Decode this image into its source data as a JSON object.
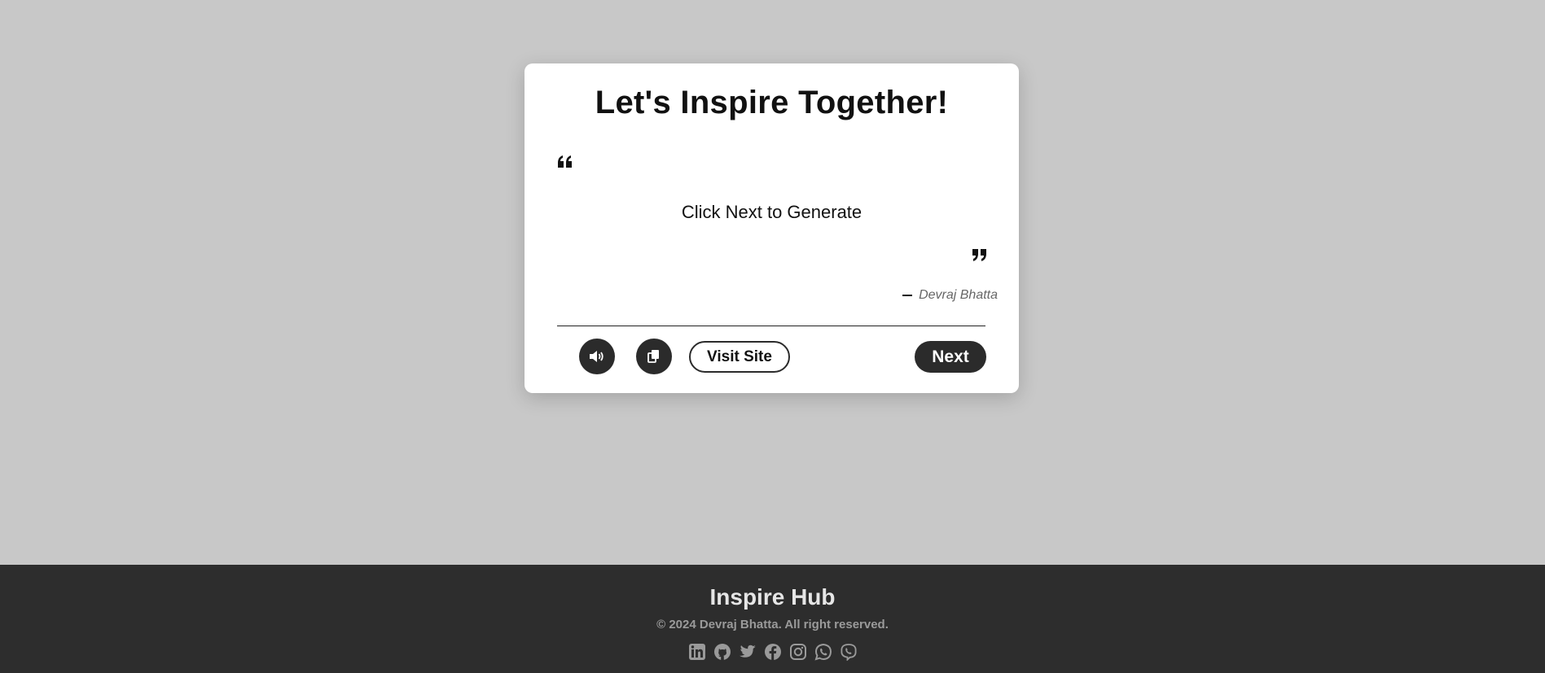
{
  "card": {
    "title": "Let's Inspire Together!",
    "quote_text": "Click Next to Generate",
    "author": "Devraj Bhatta",
    "buttons": {
      "speak_icon": "volume-icon",
      "copy_icon": "copy-icon",
      "visit_label": "Visit Site",
      "next_label": "Next"
    }
  },
  "footer": {
    "title": "Inspire Hub",
    "copyright": "© 2024 Devraj Bhatta. All right reserved.",
    "socials": [
      "linkedin-icon",
      "github-icon",
      "twitter-icon",
      "facebook-icon",
      "instagram-icon",
      "whatsapp-icon",
      "viber-icon"
    ]
  },
  "colors": {
    "background": "#c8c8c8",
    "card": "#ffffff",
    "dark": "#2b2b2b",
    "footer": "#2d2d2d",
    "footer_icon": "#9a9a9a"
  }
}
